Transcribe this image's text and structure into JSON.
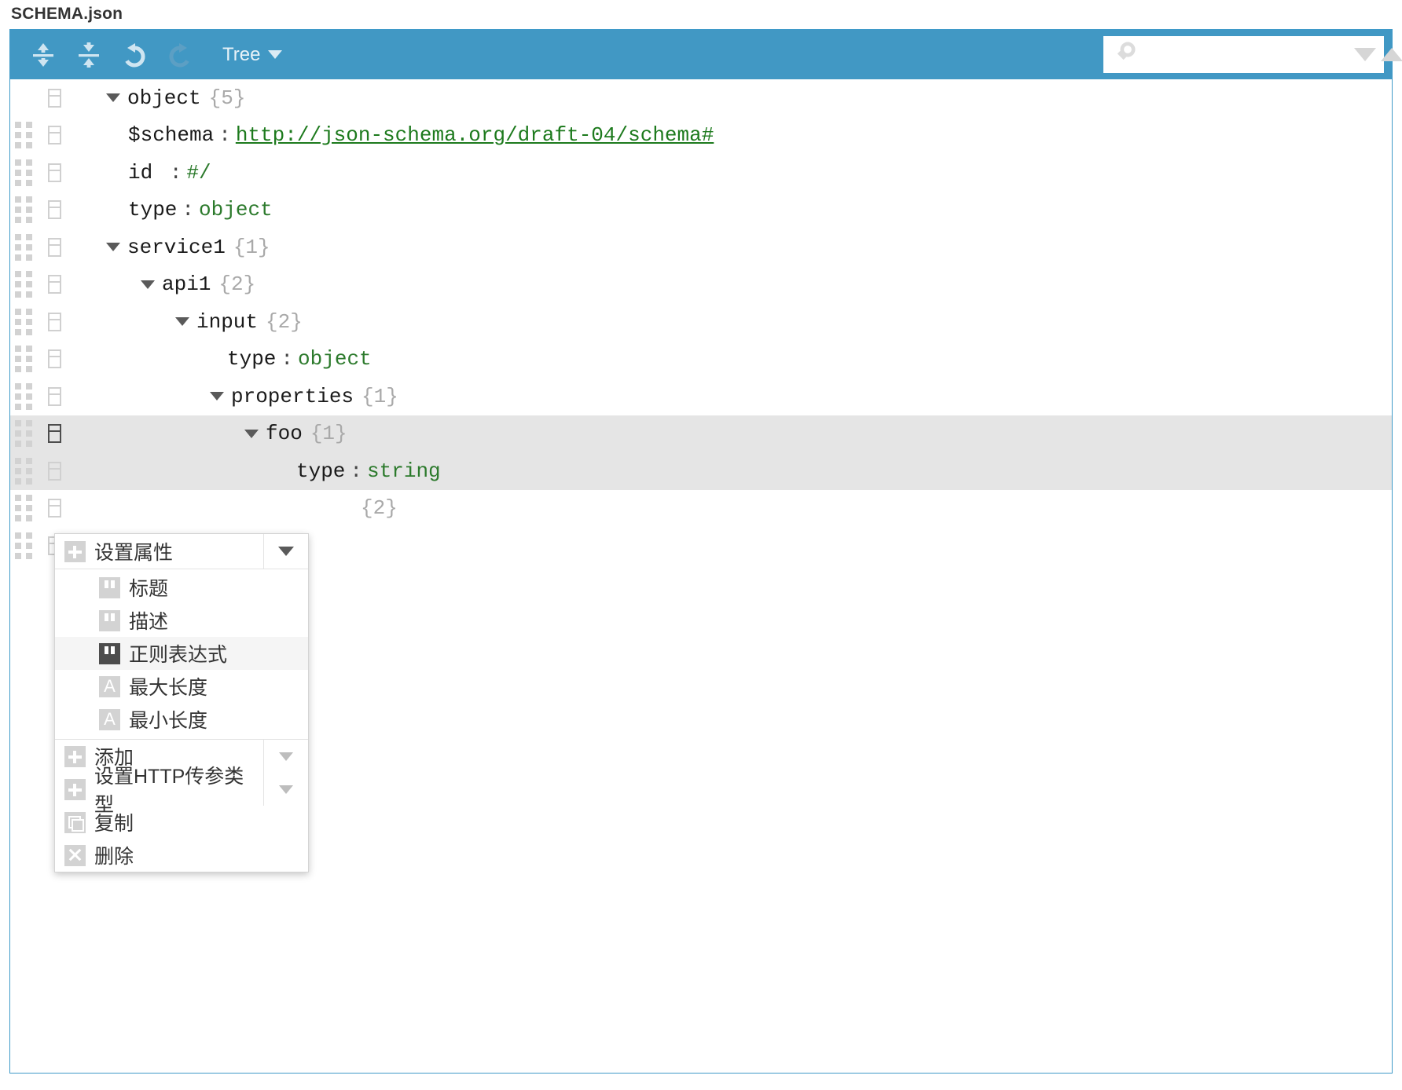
{
  "page": {
    "title": "SCHEMA.json"
  },
  "toolbar": {
    "expand_all_label": "expand-all",
    "collapse_all_label": "collapse-all",
    "undo_label": "undo",
    "redo_label": "redo",
    "mode_label": "Tree",
    "search": {
      "value": "",
      "placeholder": ""
    }
  },
  "tree": {
    "rows": [
      {
        "indent": 0,
        "expander": "down",
        "key": "object",
        "sep": "",
        "value": "",
        "count": "{5}",
        "handle": false,
        "selected": false,
        "key_style": "count"
      },
      {
        "indent": 1,
        "expander": "none",
        "key": "$schema",
        "sep": ":",
        "value": "http://json-schema.org/draft-04/schema#",
        "count": "",
        "handle": true,
        "selected": false,
        "link": true
      },
      {
        "indent": 1,
        "expander": "none",
        "key": "id ",
        "sep": ":",
        "value": "#/",
        "count": "",
        "handle": true,
        "selected": false
      },
      {
        "indent": 1,
        "expander": "none",
        "key": "type",
        "sep": ":",
        "value": "object",
        "count": "",
        "handle": true,
        "selected": false
      },
      {
        "indent": 1,
        "expander": "down",
        "key": "service1",
        "sep": "",
        "value": "",
        "count": "{1}",
        "handle": true,
        "selected": false
      },
      {
        "indent": 2,
        "expander": "down",
        "key": "api1",
        "sep": "",
        "value": "",
        "count": "{2}",
        "handle": true,
        "selected": false
      },
      {
        "indent": 3,
        "expander": "down",
        "key": "input",
        "sep": "",
        "value": "",
        "count": "{2}",
        "handle": true,
        "selected": false
      },
      {
        "indent": 4,
        "expander": "none",
        "key": "type",
        "sep": ":",
        "value": "object",
        "count": "",
        "handle": true,
        "selected": false
      },
      {
        "indent": 4,
        "expander": "down",
        "key": "properties",
        "sep": "",
        "value": "",
        "count": "{1}",
        "handle": true,
        "selected": false
      },
      {
        "indent": 5,
        "expander": "down",
        "key": "foo",
        "sep": "",
        "value": "",
        "count": "{1}",
        "handle": true,
        "selected": true
      },
      {
        "indent": 6,
        "expander": "none",
        "key": "type",
        "sep": ":",
        "value": "string",
        "count": "",
        "handle": true,
        "selected": true
      },
      {
        "indent": 5,
        "expander": "down",
        "key": "",
        "sep": "",
        "value": "",
        "count": "{2}",
        "handle": true,
        "selected": false
      },
      {
        "indent": 5,
        "expander": "none",
        "key": "",
        "sep": "",
        "value": "",
        "count": "",
        "handle": true,
        "selected": false
      }
    ]
  },
  "context_menu": {
    "header": {
      "label": "设置属性",
      "icon": "plus-icon"
    },
    "submenu": [
      {
        "label": "标题",
        "icon": "quote-icon",
        "active": false
      },
      {
        "label": "描述",
        "icon": "quote-icon",
        "active": false
      },
      {
        "label": "正则表达式",
        "icon": "quote-icon",
        "active": true
      },
      {
        "label": "最大长度",
        "icon": "letter-a-icon",
        "active": false
      },
      {
        "label": "最小长度",
        "icon": "letter-a-icon",
        "active": false
      }
    ],
    "actions": [
      {
        "label": "添加",
        "icon": "plus-icon",
        "has_arrow": true
      },
      {
        "label": "设置HTTP传参类型",
        "icon": "plus-icon",
        "has_arrow": true
      },
      {
        "label": "复制",
        "icon": "copy-icon",
        "has_arrow": false
      },
      {
        "label": "删除",
        "icon": "close-icon",
        "has_arrow": false
      }
    ]
  },
  "colors": {
    "toolbar_blue": "#4198c4",
    "value_green": "#2c7a2c",
    "selected_row": "#e5e5e5"
  }
}
